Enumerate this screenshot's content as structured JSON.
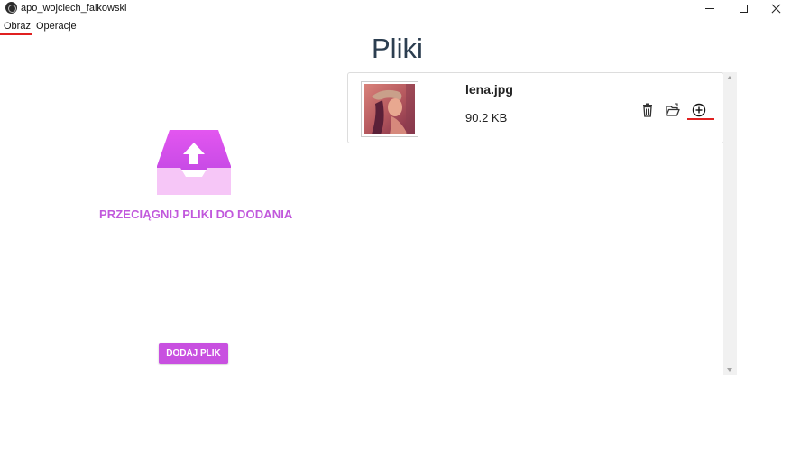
{
  "window": {
    "title": "apo_wojciech_falkowski"
  },
  "menu": {
    "items": [
      {
        "label": "Obraz"
      },
      {
        "label": "Operacje"
      }
    ]
  },
  "page": {
    "title": "Pliki"
  },
  "dropzone": {
    "text": "PRZECIĄGNIJ PLIKI DO DODANIA",
    "button_label": "DODAJ PLIK",
    "icon": "upload-tray-icon",
    "accent_color": "#c850e0"
  },
  "files": [
    {
      "name": "lena.jpg",
      "size": "90.2 KB",
      "actions": [
        "trash-icon",
        "folder-open-icon",
        "plus-circle-icon"
      ]
    }
  ],
  "colors": {
    "title": "#2c3e50",
    "accent": "#c850e0",
    "highlight": "#e02020"
  }
}
